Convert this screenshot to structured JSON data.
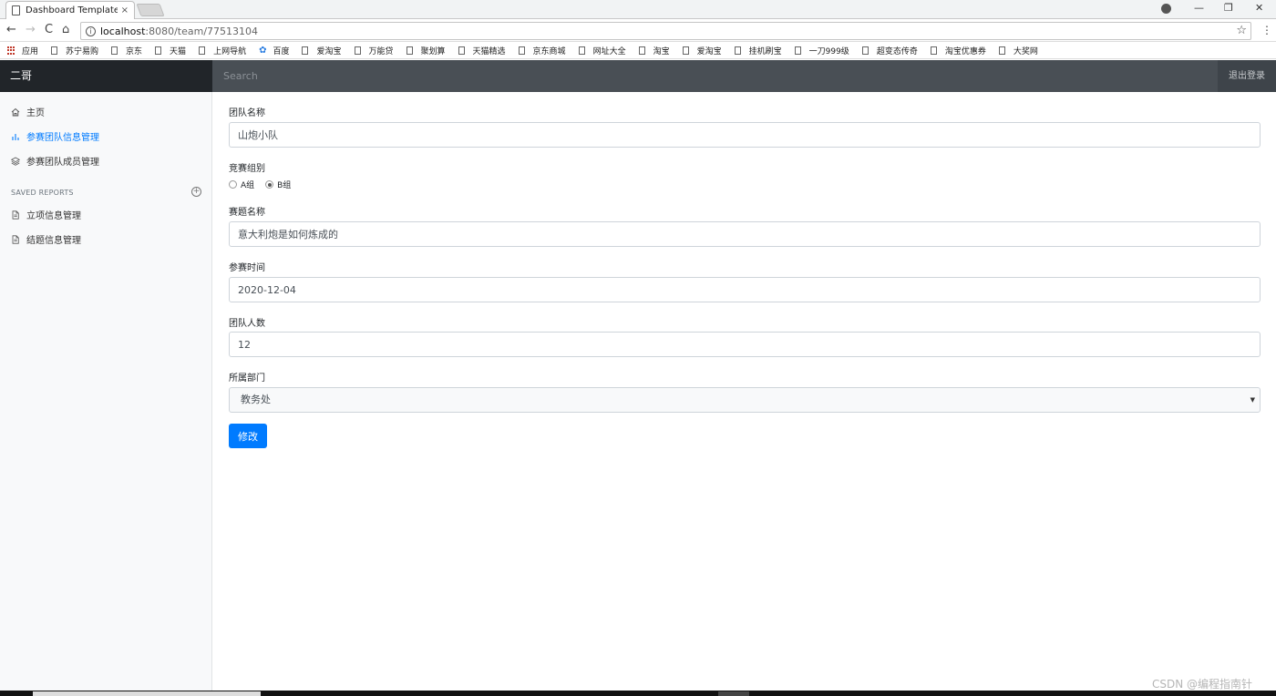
{
  "browser": {
    "tab_title": "Dashboard Template fo",
    "tab_close": "×",
    "url_host": "localhost",
    "url_path": ":8080/team/77513104",
    "back": "←",
    "forward": "→",
    "reload": "C",
    "home": "⌂",
    "star": "☆",
    "menu": "⋮",
    "minimize": "—",
    "restore": "❐",
    "close": "✕",
    "bookmarks": [
      "应用",
      "苏宁易购",
      "京东",
      "天猫",
      "上网导航",
      "百度",
      "爱淘宝",
      "万能贷",
      "聚划算",
      "天猫精选",
      "京东商城",
      "网址大全",
      "淘宝",
      "爱淘宝",
      "挂机刷宝",
      "一刀999级",
      "超变态传奇",
      "淘宝优惠券",
      "大奖网"
    ]
  },
  "navbar": {
    "brand": "二哥",
    "search_placeholder": "Search",
    "signout": "退出登录"
  },
  "sidebar": {
    "items": [
      {
        "label": "主页",
        "icon": "home-icon"
      },
      {
        "label": "参赛团队信息管理",
        "icon": "bar-chart-icon",
        "active": true
      },
      {
        "label": "参赛团队成员管理",
        "icon": "layers-icon"
      }
    ],
    "section_title": "SAVED REPORTS",
    "section_plus": "+",
    "reports": [
      {
        "label": "立项信息管理",
        "icon": "file-text-icon"
      },
      {
        "label": "结题信息管理",
        "icon": "file-text-icon"
      }
    ]
  },
  "form": {
    "team_name_label": "团队名称",
    "team_name_value": "山炮小队",
    "group_label": "竞赛组别",
    "group_options": [
      "A组",
      "B组"
    ],
    "group_selected": "B组",
    "topic_label": "赛题名称",
    "topic_value": "意大利炮是如何炼成的",
    "date_label": "参赛时间",
    "date_value": "2020-12-04",
    "count_label": "团队人数",
    "count_value": "12",
    "dept_label": "所属部门",
    "dept_value": "教务处",
    "submit_label": "修改"
  },
  "watermark": "CSDN @编程指南针",
  "colors": {
    "primary": "#007bff",
    "navbar": "#343a40",
    "brand_bg": "#212529"
  }
}
